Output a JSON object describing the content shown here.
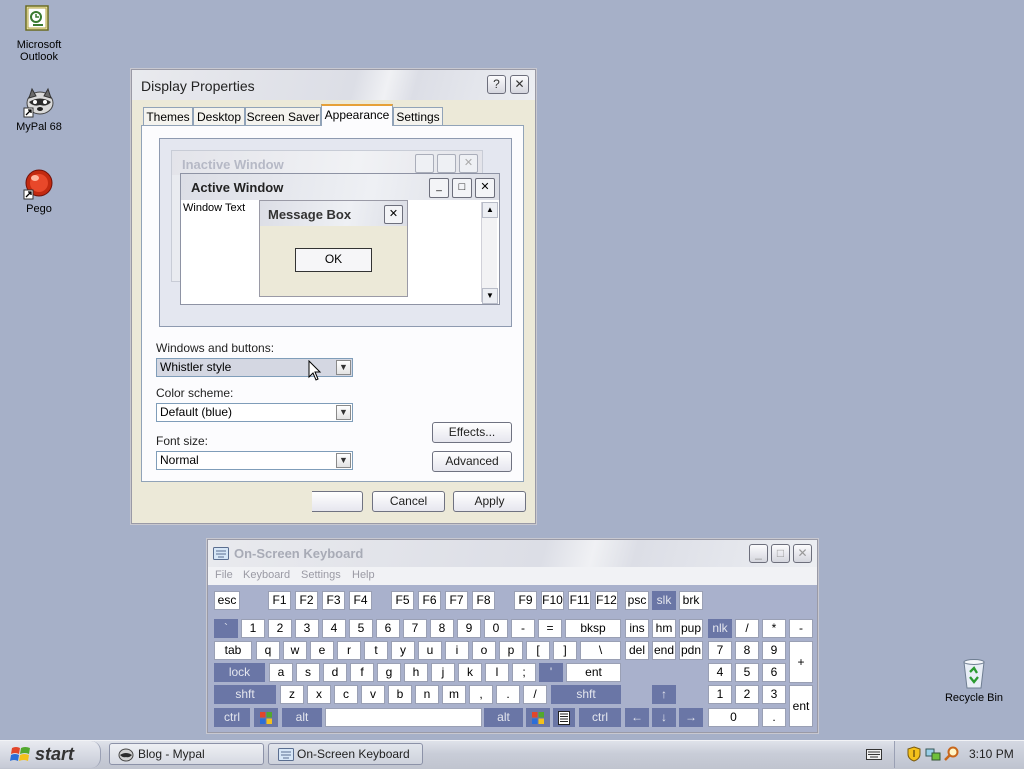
{
  "desktop": {
    "icons": [
      {
        "label_line1": "Microsoft",
        "label_line2": "Outlook"
      },
      {
        "label_line1": "MyPal 68",
        "label_line2": ""
      },
      {
        "label_line1": "Pego",
        "label_line2": ""
      },
      {
        "label_line1": "Recycle Bin",
        "label_line2": ""
      }
    ]
  },
  "display_properties": {
    "title": "Display Properties",
    "help_glyph": "?",
    "close_glyph": "✕",
    "tabs": [
      "Themes",
      "Desktop",
      "Screen Saver",
      "Appearance",
      "Settings"
    ],
    "active_tab": "Appearance",
    "preview": {
      "inactive_title": "Inactive Window",
      "active_title": "Active Window",
      "window_text": "Window Text",
      "message_title": "Message Box",
      "ok_label": "OK"
    },
    "windows_buttons_label": "Windows and buttons:",
    "windows_buttons_value": "Whistler style",
    "color_scheme_label": "Color scheme:",
    "color_scheme_value": "Default (blue)",
    "font_size_label": "Font size:",
    "font_size_value": "Normal",
    "effects_label": "Effects...",
    "advanced_label": "Advanced",
    "cancel_label": "Cancel",
    "apply_label": "Apply"
  },
  "osk": {
    "title": "On-Screen Keyboard",
    "menu": [
      "File",
      "Keyboard",
      "Settings",
      "Help"
    ],
    "keys": {
      "esc": "esc",
      "f1": "F1",
      "f2": "F2",
      "f3": "F3",
      "f4": "F4",
      "f5": "F5",
      "f6": "F6",
      "f7": "F7",
      "f8": "F8",
      "f9": "F9",
      "f10": "F10",
      "f11": "F11",
      "f12": "F12",
      "psc": "psc",
      "slk": "slk",
      "brk": "brk",
      "grave": "`",
      "n1": "1",
      "n2": "2",
      "n3": "3",
      "n4": "4",
      "n5": "5",
      "n6": "6",
      "n7": "7",
      "n8": "8",
      "n9": "9",
      "n0": "0",
      "minus": "-",
      "equals": "=",
      "bksp": "bksp",
      "ins": "ins",
      "hm": "hm",
      "pup": "pup",
      "nlk": "nlk",
      "np_div": "/",
      "np_mul": "*",
      "np_sub": "-",
      "tab": "tab",
      "q": "q",
      "w": "w",
      "e": "e",
      "r": "r",
      "t": "t",
      "y": "y",
      "u": "u",
      "i": "i",
      "o": "o",
      "p": "p",
      "lbr": "[",
      "rbr": "]",
      "bslash": "\\",
      "del": "del",
      "end": "end",
      "pdn": "pdn",
      "np7": "7",
      "np8": "8",
      "np9": "9",
      "np_add": "+",
      "lock": "lock",
      "a": "a",
      "s": "s",
      "d": "d",
      "f": "f",
      "g": "g",
      "h": "h",
      "j": "j",
      "k": "k",
      "l": "l",
      "semi": ";",
      "quote": "'",
      "ent": "ent",
      "np4": "4",
      "np5": "5",
      "np6": "6",
      "lshft": "shft",
      "z": "z",
      "x": "x",
      "c": "c",
      "v": "v",
      "b": "b",
      "n": "n",
      "m": "m",
      "comma": ",",
      "period": ".",
      "slash": "/",
      "rshft": "shft",
      "up": "↑",
      "np1": "1",
      "np2": "2",
      "np3": "3",
      "np_ent": "ent",
      "lctrl": "ctrl",
      "lalt": "alt",
      "ralt": "alt",
      "rctrl": "ctrl",
      "left": "←",
      "down": "↓",
      "right": "→",
      "np0": "0",
      "np_dot": "."
    }
  },
  "taskbar": {
    "start_label": "start",
    "buttons": [
      "Blog - Mypal",
      "On-Screen Keyboard"
    ],
    "clock": "3:10 PM"
  }
}
